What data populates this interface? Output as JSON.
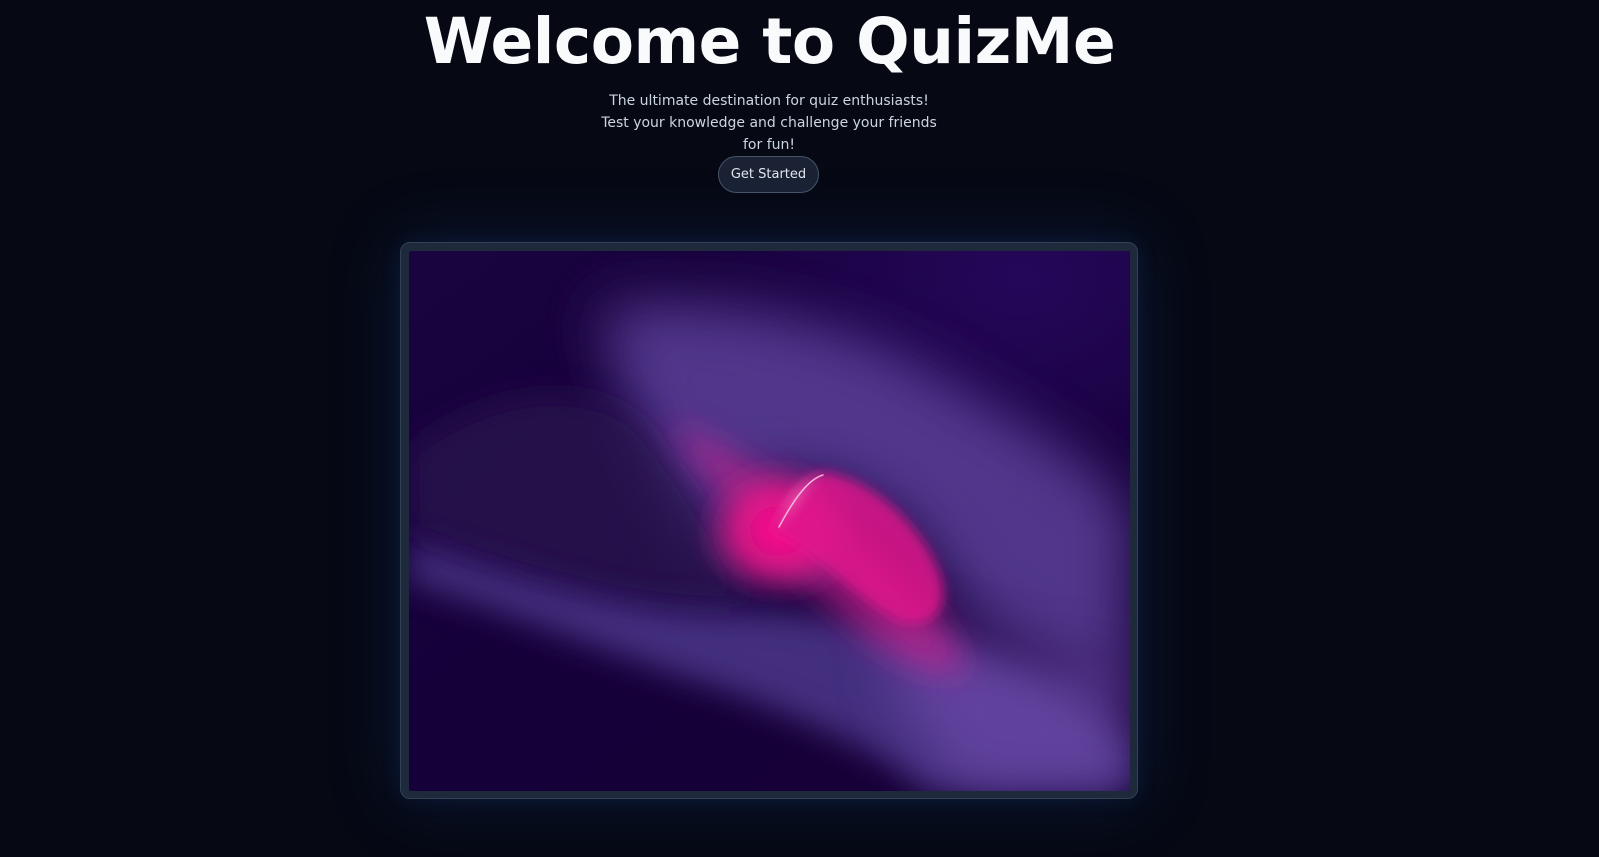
{
  "hero": {
    "title": "Welcome to QuizMe",
    "subtitle": "The ultimate destination for quiz enthusiasts! Test your knowledge and challenge your friends for fun!",
    "cta_label": "Get Started"
  },
  "colors": {
    "background": "#060914",
    "accent_pink": "#ff0a8a",
    "accent_purple": "#5a3f98",
    "deep_purple": "#14002f"
  },
  "preview": {
    "image_name": "abstract-purple-pink-wave-artwork"
  }
}
